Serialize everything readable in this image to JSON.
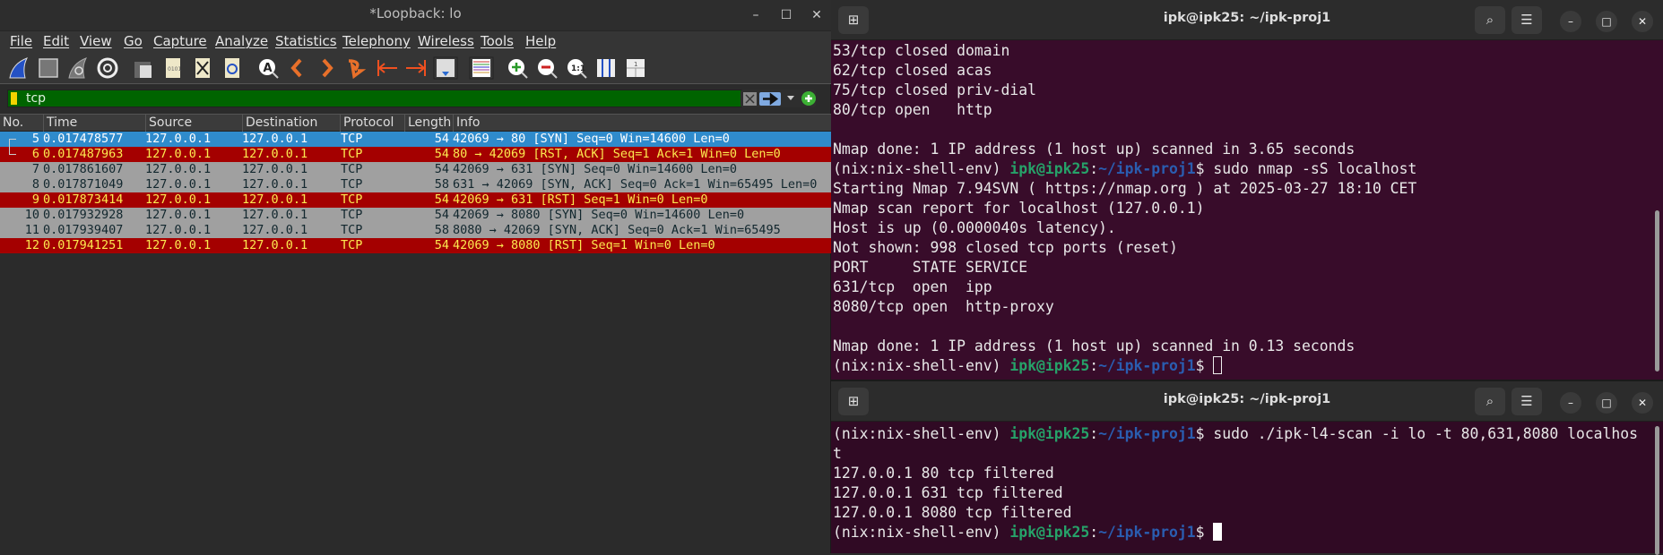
{
  "wireshark": {
    "title": "*Loopback: lo",
    "window_controls": {
      "minimize": "–",
      "maximize": "☐",
      "close": "✕"
    },
    "menu": [
      "File",
      "Edit",
      "View",
      "Go",
      "Capture",
      "Analyze",
      "Statistics",
      "Telephony",
      "Wireless",
      "Tools",
      "Help"
    ],
    "toolbar_icons": [
      "start-capture-icon",
      "stop-capture-icon",
      "restart-capture-icon",
      "capture-options-icon",
      "open-file-icon",
      "save-file-icon",
      "close-file-icon",
      "reload-file-icon",
      "find-packet-icon",
      "go-back-icon",
      "go-forward-icon",
      "go-to-packet-icon",
      "go-first-icon",
      "go-last-icon",
      "autoscroll-icon",
      "colorize-icon",
      "zoom-in-icon",
      "zoom-out-icon",
      "normal-size-icon",
      "resize-columns-icon",
      "layout-icon"
    ],
    "filter": {
      "value": "tcp",
      "color": "#006400"
    },
    "columns": [
      "No.",
      "Time",
      "Source",
      "Destination",
      "Protocol",
      "Length",
      "Info"
    ],
    "packets": [
      {
        "no": "5",
        "time": "0.017478577",
        "src": "127.0.0.1",
        "dst": "127.0.0.1",
        "proto": "TCP",
        "len": "54",
        "info": "42069 → 80 [SYN] Seq=0 Win=14600 Len=0",
        "style": "sel"
      },
      {
        "no": "6",
        "time": "0.017487963",
        "src": "127.0.0.1",
        "dst": "127.0.0.1",
        "proto": "TCP",
        "len": "54",
        "info": "80 → 42069 [RST, ACK] Seq=1 Ack=1 Win=0 Len=0",
        "style": "red"
      },
      {
        "no": "7",
        "time": "0.017861607",
        "src": "127.0.0.1",
        "dst": "127.0.0.1",
        "proto": "TCP",
        "len": "54",
        "info": "42069 → 631 [SYN] Seq=0 Win=14600 Len=0",
        "style": "gray"
      },
      {
        "no": "8",
        "time": "0.017871049",
        "src": "127.0.0.1",
        "dst": "127.0.0.1",
        "proto": "TCP",
        "len": "58",
        "info": "631 → 42069 [SYN, ACK] Seq=0 Ack=1 Win=65495 Len=0",
        "style": "gray"
      },
      {
        "no": "9",
        "time": "0.017873414",
        "src": "127.0.0.1",
        "dst": "127.0.0.1",
        "proto": "TCP",
        "len": "54",
        "info": "42069 → 631 [RST] Seq=1 Win=0 Len=0",
        "style": "red"
      },
      {
        "no": "10",
        "time": "0.017932928",
        "src": "127.0.0.1",
        "dst": "127.0.0.1",
        "proto": "TCP",
        "len": "54",
        "info": "42069 → 8080 [SYN] Seq=0 Win=14600 Len=0",
        "style": "gray"
      },
      {
        "no": "11",
        "time": "0.017939407",
        "src": "127.0.0.1",
        "dst": "127.0.0.1",
        "proto": "TCP",
        "len": "58",
        "info": "8080 → 42069 [SYN, ACK] Seq=0 Ack=1 Win=65495",
        "style": "gray"
      },
      {
        "no": "12",
        "time": "0.017941251",
        "src": "127.0.0.1",
        "dst": "127.0.0.1",
        "proto": "TCP",
        "len": "54",
        "info": "42069 → 8080 [RST] Seq=1 Win=0 Len=0",
        "style": "red"
      }
    ]
  },
  "terminal_top": {
    "title": "ipk@ipk25: ~/ipk-proj1",
    "lines": [
      [
        {
          "t": "53/tcp closed domain"
        }
      ],
      [
        {
          "t": "62/tcp closed acas"
        }
      ],
      [
        {
          "t": "75/tcp closed priv-dial"
        }
      ],
      [
        {
          "t": "80/tcp open   http"
        }
      ],
      [
        {
          "t": ""
        }
      ],
      [
        {
          "t": "Nmap done: 1 IP address (1 host up) scanned in 3.65 seconds"
        }
      ],
      [
        {
          "t": "(nix:nix-shell-env) "
        },
        {
          "t": "ipk@ipk25",
          "c": "user"
        },
        {
          "t": ":"
        },
        {
          "t": "~/ipk-proj1",
          "c": "path"
        },
        {
          "t": "$ sudo nmap -sS localhost"
        }
      ],
      [
        {
          "t": "Starting Nmap 7.94SVN ( https://nmap.org ) at 2025-03-27 18:10 CET"
        }
      ],
      [
        {
          "t": "Nmap scan report for localhost (127.0.0.1)"
        }
      ],
      [
        {
          "t": "Host is up (0.0000040s latency)."
        }
      ],
      [
        {
          "t": "Not shown: 998 closed tcp ports (reset)"
        }
      ],
      [
        {
          "t": "PORT     STATE SERVICE"
        }
      ],
      [
        {
          "t": "631/tcp  open  ipp"
        }
      ],
      [
        {
          "t": "8080/tcp open  http-proxy"
        }
      ],
      [
        {
          "t": ""
        }
      ],
      [
        {
          "t": "Nmap done: 1 IP address (1 host up) scanned in 0.13 seconds"
        }
      ],
      [
        {
          "t": "(nix:nix-shell-env) "
        },
        {
          "t": "ipk@ipk25",
          "c": "user"
        },
        {
          "t": ":"
        },
        {
          "t": "~/ipk-proj1",
          "c": "path"
        },
        {
          "t": "$ "
        },
        {
          "cursor": "hollow"
        }
      ]
    ]
  },
  "terminal_bottom": {
    "title": "ipk@ipk25: ~/ipk-proj1",
    "lines": [
      [
        {
          "t": "(nix:nix-shell-env) "
        },
        {
          "t": "ipk@ipk25",
          "c": "user"
        },
        {
          "t": ":"
        },
        {
          "t": "~/ipk-proj1",
          "c": "path"
        },
        {
          "t": "$ sudo ./ipk-l4-scan -i lo -t 80,631,8080 localhos"
        }
      ],
      [
        {
          "t": "t"
        }
      ],
      [
        {
          "t": "127.0.0.1 80 tcp filtered"
        }
      ],
      [
        {
          "t": "127.0.0.1 631 tcp filtered"
        }
      ],
      [
        {
          "t": "127.0.0.1 8080 tcp filtered"
        }
      ],
      [
        {
          "t": "(nix:nix-shell-env) "
        },
        {
          "t": "ipk@ipk25",
          "c": "user"
        },
        {
          "t": ":"
        },
        {
          "t": "~/ipk-proj1",
          "c": "path"
        },
        {
          "t": "$ "
        },
        {
          "cursor": "solid"
        }
      ]
    ]
  },
  "terminal_buttons": {
    "new_tab": "⊞",
    "search": "⌕",
    "menu": "☰",
    "minimize": "–",
    "maximize": "□",
    "close": "✕"
  }
}
